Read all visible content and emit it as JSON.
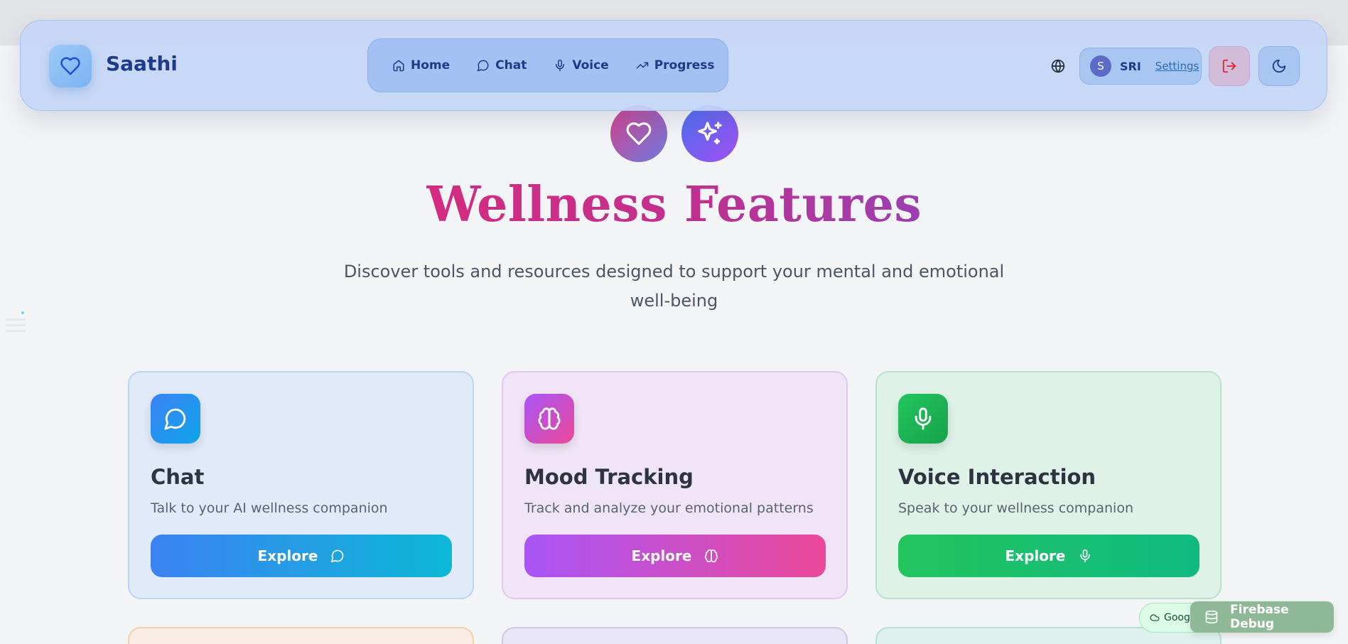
{
  "app": {
    "name": "Saathi"
  },
  "nav": {
    "items": [
      {
        "label": "Home",
        "icon": "home-icon"
      },
      {
        "label": "Chat",
        "icon": "chat-icon"
      },
      {
        "label": "Voice",
        "icon": "mic-icon"
      },
      {
        "label": "Progress",
        "icon": "trending-up-icon"
      }
    ]
  },
  "user": {
    "initial": "S",
    "name": "SRI",
    "settings_label": "Settings"
  },
  "hero": {
    "title": "Wellness Features",
    "subtitle": "Discover tools and resources designed to support your mental and emotional well-being"
  },
  "features": [
    {
      "title": "Chat",
      "description": "Talk to your AI wellness companion",
      "button": "Explore",
      "icon": "chat-icon",
      "accent": "#3b82f6"
    },
    {
      "title": "Mood Tracking",
      "description": "Track and analyze your emotional patterns",
      "button": "Explore",
      "icon": "brain-icon",
      "accent": "#a855f7"
    },
    {
      "title": "Voice Interaction",
      "description": "Speak to your wellness companion",
      "button": "Explore",
      "icon": "mic-icon",
      "accent": "#22c55e"
    }
  ],
  "badges": {
    "google": "Google",
    "firebase": "Firebase Debug"
  },
  "colors": {
    "brand": "#1e3a8a",
    "title_gradient": [
      "#d42b80",
      "#9a3fb0"
    ]
  }
}
